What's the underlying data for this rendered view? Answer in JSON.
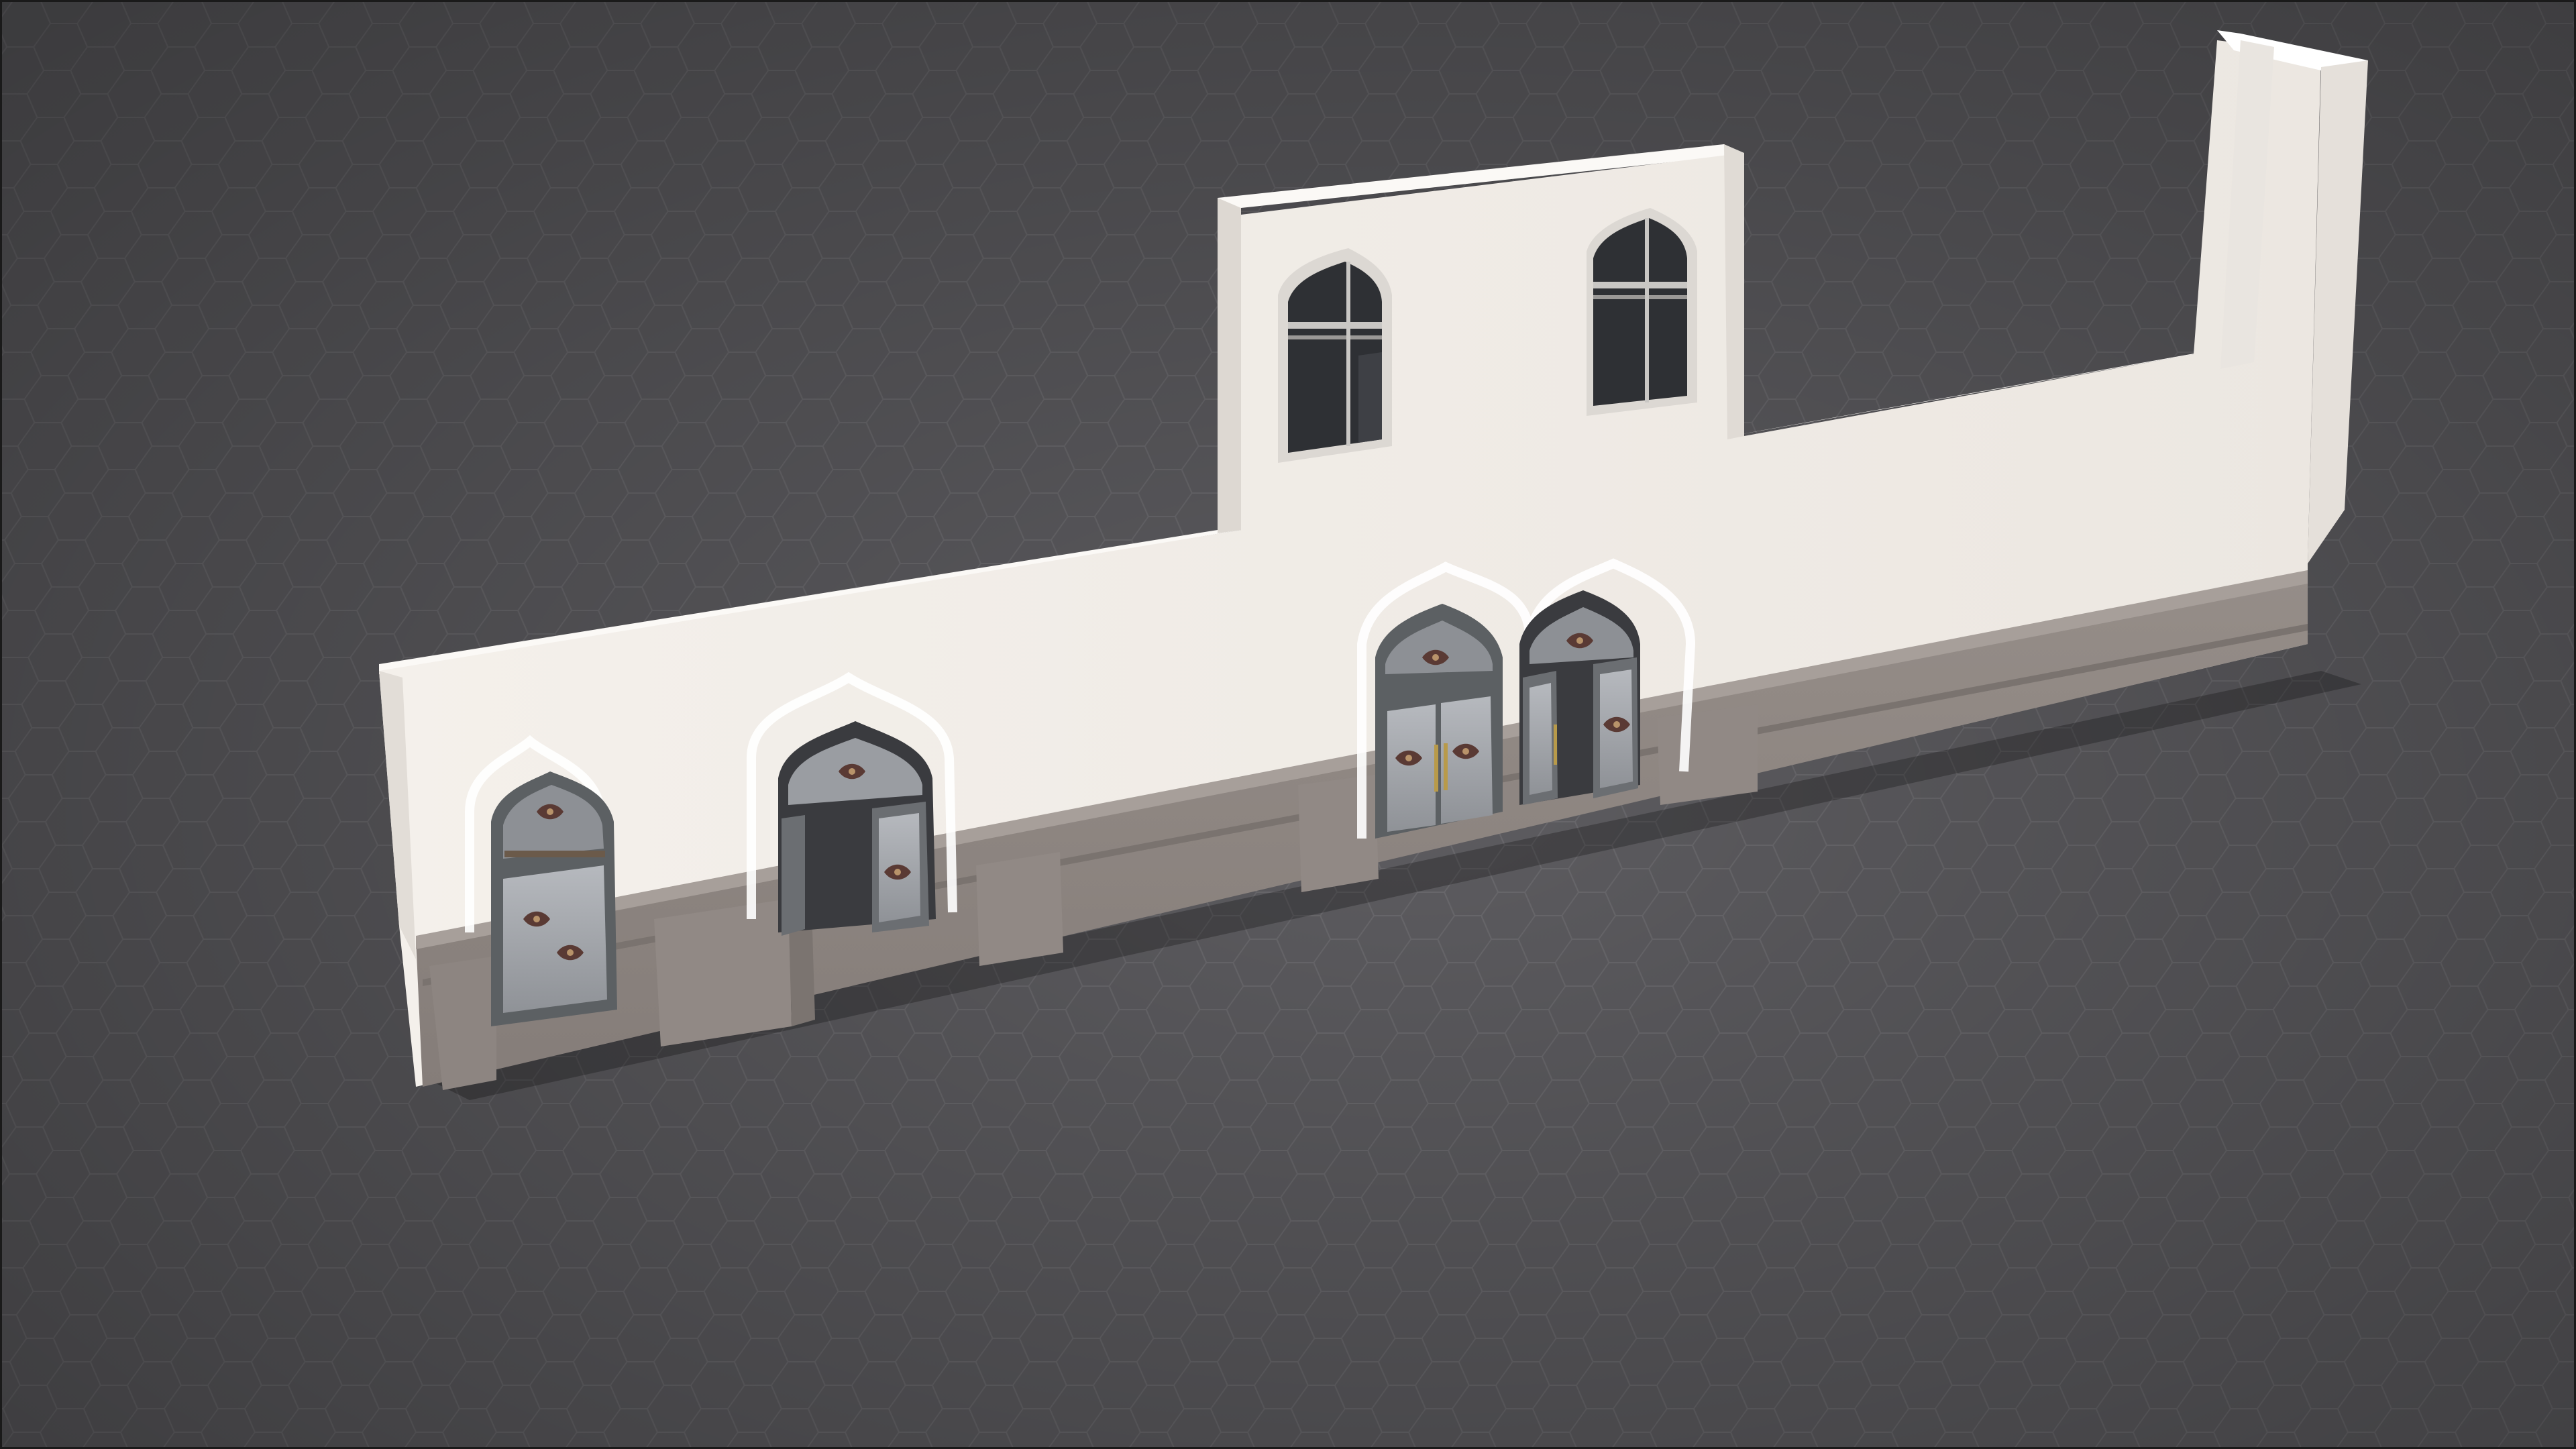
{
  "scene": {
    "subject": "facade-wall-3d-render",
    "colors": {
      "floor_base": "#5f5e62",
      "floor_dark": "#4e4d51",
      "floor_line": "#6b6a6e",
      "wall_front": "#f1ede8",
      "wall_front_shade": "#e6e1db",
      "wall_top": "#fbf9f6",
      "wall_side": "#dcd7d1",
      "plinth_front": "#8f8783",
      "plinth_top": "#a39b96",
      "plinth_shadow": "#756e6a",
      "door_frame": "#5c6063",
      "door_glass": "#a6a9ae",
      "door_ornament": "#5a3a34",
      "door_handle": "#b89a4a",
      "window_glass": "#2e3034",
      "window_frame": "#c9c7c4",
      "border": "#1a1a1a"
    }
  }
}
